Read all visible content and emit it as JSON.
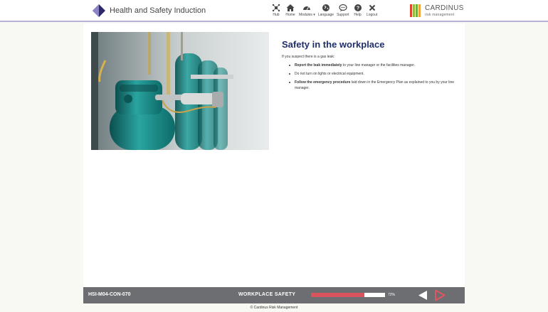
{
  "header": {
    "app_title": "Health and Safety Induction",
    "nav": [
      {
        "label": "Hub",
        "icon": "hub-icon"
      },
      {
        "label": "Home",
        "icon": "home-icon"
      },
      {
        "label": "Modules ▾",
        "icon": "dashboard-icon"
      },
      {
        "label": "Language",
        "icon": "globe-icon"
      },
      {
        "label": "Support",
        "icon": "chat-icon"
      },
      {
        "label": "Help",
        "icon": "help-icon"
      },
      {
        "label": "Logout",
        "icon": "close-icon"
      }
    ],
    "brand": {
      "name": "CARDINUS",
      "sub": "risk management",
      "colors": [
        "#e2412f",
        "#8fbd3f",
        "#6fae3d",
        "#f2a23a"
      ]
    }
  },
  "main": {
    "title": "Safety in the workplace",
    "intro": "If you suspect there is a gas leak:",
    "bullets": [
      {
        "bold": "Report the leak immediately",
        "rest": " to your line manager or the facilities manager."
      },
      {
        "bold": "",
        "rest": "Do not turn on lights or electrical equipment."
      },
      {
        "bold": "Follow the emergency procedure",
        "rest": " laid down in the Emergency Plan as explained to you by your line manager."
      }
    ],
    "image": "gas-cylinders-photo"
  },
  "footer": {
    "code": "HSI-M04-CON-070",
    "section": "WORKPLACE SAFETY",
    "progress": 0.72,
    "progress_label": "72%",
    "accent": "#d9545e"
  },
  "copyright": "© Cardinus Risk Management"
}
